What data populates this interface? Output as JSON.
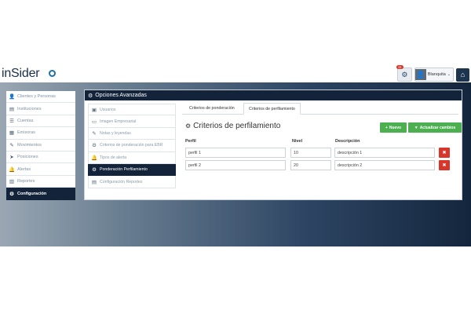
{
  "app": {
    "logo_text": "inSider",
    "notification_count": "11",
    "user_name": "Blanquita",
    "colors": {
      "navy": "#13233a",
      "green": "#4caf50",
      "red": "#d9362b",
      "brand_blue": "#1e6fa8"
    }
  },
  "sidebar": {
    "items": [
      {
        "label": "Clientes y Personas",
        "icon": "person-icon"
      },
      {
        "label": "Instituciones",
        "icon": "building-icon"
      },
      {
        "label": "Cuentas",
        "icon": "list-icon"
      },
      {
        "label": "Emisoras",
        "icon": "document-icon"
      },
      {
        "label": "Movimientos",
        "icon": "edit-icon"
      },
      {
        "label": "Posiciones",
        "icon": "navigation-icon"
      },
      {
        "label": "Alertas",
        "icon": "bell-icon"
      },
      {
        "label": "Reportes",
        "icon": "bar-chart-icon"
      },
      {
        "label": "Configuración",
        "icon": "gears-icon",
        "active": true
      }
    ]
  },
  "panel": {
    "title": "Opciones Avanzadas",
    "subnav": [
      {
        "label": "Usuarios",
        "icon": "user-file-icon"
      },
      {
        "label": "Imagen Empresarial",
        "icon": "image-icon"
      },
      {
        "label": "Notas y leyendas",
        "icon": "edit-icon"
      },
      {
        "label": "Criterios de ponderación para EBR",
        "icon": "gears-icon"
      },
      {
        "label": "Tipos de alerta",
        "icon": "bell-icon"
      },
      {
        "label": "Ponderación Perfilamiento",
        "icon": "gears-icon",
        "active": true
      },
      {
        "label": "Configuración Reportes",
        "icon": "document-icon"
      }
    ]
  },
  "tabs": [
    {
      "label": "Criterios de ponderación"
    },
    {
      "label": "Criterios de perfilamiento",
      "active": true
    }
  ],
  "section": {
    "title": "Criterios de perfilamiento",
    "new_button": "Nuevo",
    "update_button": "Actualizar cambios"
  },
  "table": {
    "columns": [
      "Perfil",
      "Nivel",
      "Descripción"
    ],
    "rows": [
      {
        "perfil": "perfil 1",
        "nivel": "10",
        "descripcion": "descripción 1"
      },
      {
        "perfil": "perfil 2",
        "nivel": "20",
        "descripcion": "descripción 2"
      }
    ]
  }
}
